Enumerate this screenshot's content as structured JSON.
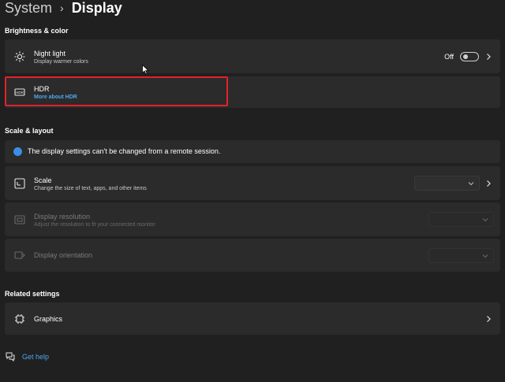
{
  "breadcrumb": {
    "parent": "System",
    "separator": "›",
    "current": "Display"
  },
  "brightness": {
    "heading": "Brightness & color",
    "night_light": {
      "title": "Night light",
      "subtitle": "Display warmer colors",
      "state": "Off"
    },
    "hdr": {
      "title": "HDR",
      "link": "More about HDR"
    }
  },
  "scale_layout": {
    "heading": "Scale & layout",
    "notice": "The display settings can't be changed from a remote session.",
    "scale": {
      "title": "Scale",
      "subtitle": "Change the size of text, apps, and other items",
      "value": ""
    },
    "resolution": {
      "title": "Display resolution",
      "subtitle": "Adjust the resolution to fit your connected monitor",
      "value": ""
    },
    "orientation": {
      "title": "Display orientation",
      "value": ""
    }
  },
  "related": {
    "heading": "Related settings",
    "graphics": {
      "title": "Graphics"
    }
  },
  "help": {
    "label": "Get help"
  },
  "colors": {
    "background": "#202020",
    "card": "#2b2b2b",
    "link": "#4ea6f0",
    "highlight": "#e3212b",
    "info": "#3a8ee6"
  },
  "icons": [
    "brightness-icon",
    "hdr-icon",
    "info-icon",
    "scale-icon",
    "resolution-icon",
    "orientation-icon",
    "graphics-chip-icon",
    "help-icon",
    "chevron-right-icon",
    "chevron-down-icon"
  ]
}
